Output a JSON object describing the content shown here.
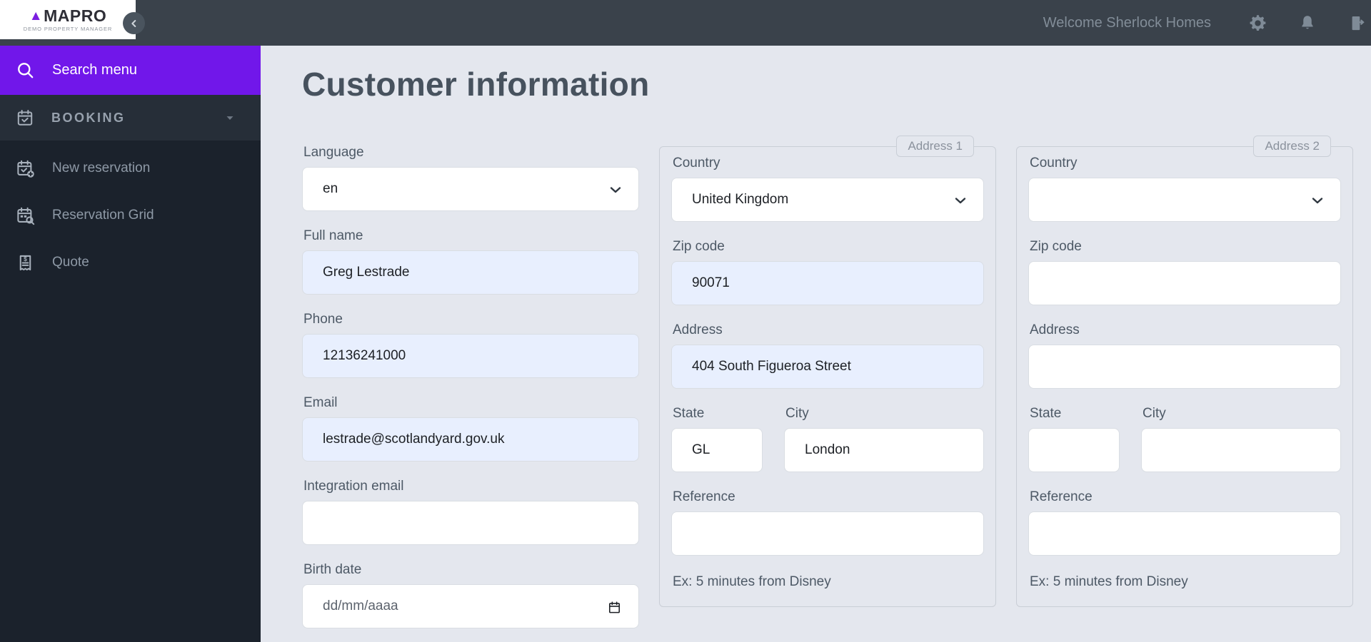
{
  "brand": {
    "logo_mark": "▲",
    "logo_text": "MAPRO",
    "subtitle": "DEMO PROPERTY MANAGER"
  },
  "topbar": {
    "welcome_text": "Welcome Sherlock Homes"
  },
  "sidebar": {
    "search_label": "Search menu",
    "booking_section_label": "BOOKING",
    "items": [
      {
        "label": "New reservation"
      },
      {
        "label": "Reservation Grid"
      },
      {
        "label": "Quote"
      }
    ]
  },
  "page": {
    "title": "Customer information"
  },
  "form": {
    "language": {
      "label": "Language",
      "value": "en"
    },
    "full_name": {
      "label": "Full name",
      "value": "Greg Lestrade"
    },
    "phone": {
      "label": "Phone",
      "value": "12136241000"
    },
    "email": {
      "label": "Email",
      "value": "lestrade@scotlandyard.gov.uk"
    },
    "integration_email": {
      "label": "Integration email",
      "value": ""
    },
    "birth_date": {
      "label": "Birth date",
      "placeholder": "dd/mm/aaaa"
    }
  },
  "address1": {
    "legend": "Address 1",
    "country": {
      "label": "Country",
      "value": "United Kingdom"
    },
    "zip": {
      "label": "Zip code",
      "value": "90071"
    },
    "address": {
      "label": "Address",
      "value": "404 South Figueroa Street"
    },
    "state": {
      "label": "State",
      "value": "GL"
    },
    "city": {
      "label": "City",
      "value": "London"
    },
    "reference": {
      "label": "Reference",
      "value": ""
    },
    "hint": "Ex: 5 minutes from Disney"
  },
  "address2": {
    "legend": "Address 2",
    "country": {
      "label": "Country",
      "value": ""
    },
    "zip": {
      "label": "Zip code",
      "value": ""
    },
    "address": {
      "label": "Address",
      "value": ""
    },
    "state": {
      "label": "State",
      "value": ""
    },
    "city": {
      "label": "City",
      "value": ""
    },
    "reference": {
      "label": "Reference",
      "value": ""
    },
    "hint": "Ex: 5 minutes from Disney"
  },
  "colors": {
    "accent_purple": "#7117ea",
    "topbar_bg": "#3a424b",
    "sidebar_bg": "#1b222c",
    "page_bg": "#e4e7ee",
    "filled_input_bg": "#e8effe"
  }
}
